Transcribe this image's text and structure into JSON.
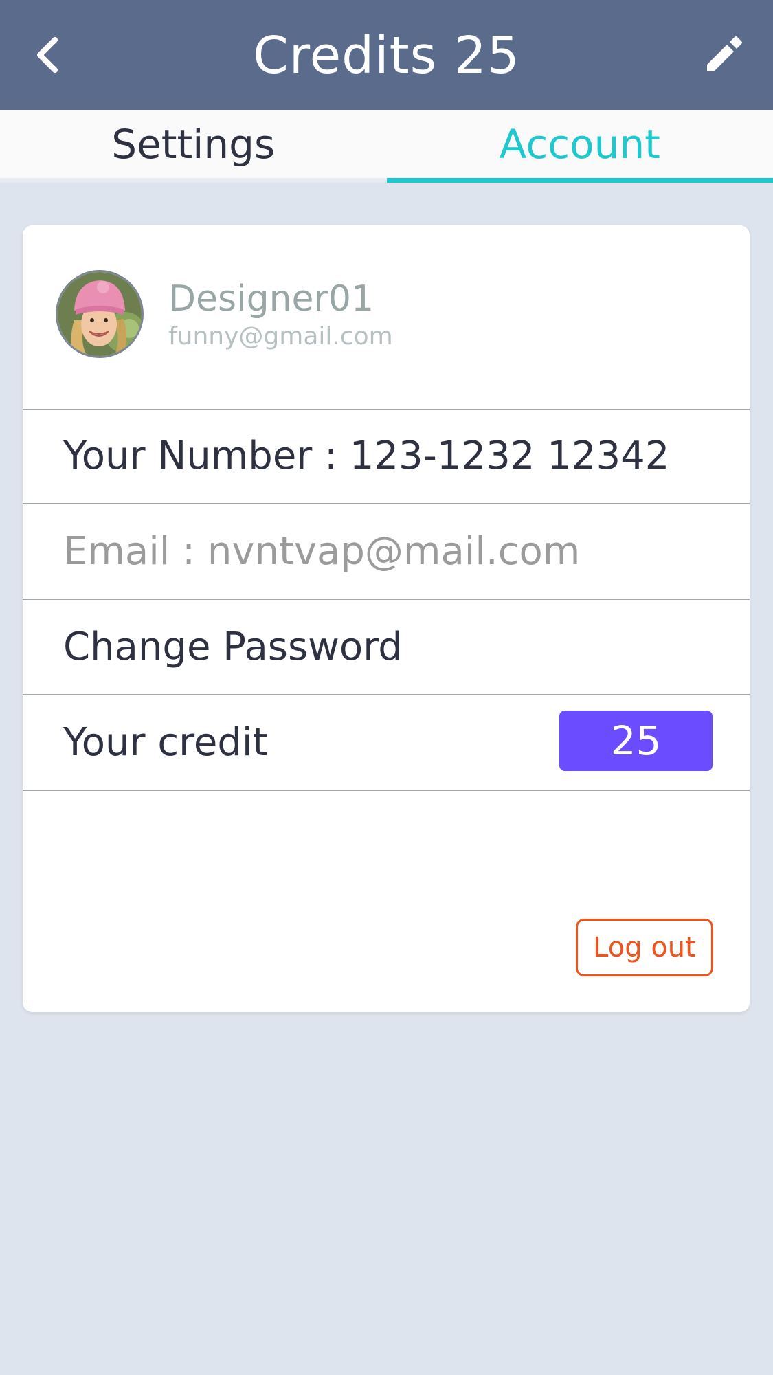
{
  "header": {
    "title": "Credits 25",
    "back_icon": "chevron-left-icon",
    "edit_icon": "pencil-icon",
    "background_color": "#5b6b8b"
  },
  "tabs": [
    {
      "label": "Settings",
      "active": false
    },
    {
      "label": "Account",
      "active": true
    }
  ],
  "accent_color": "#1dc9cc",
  "profile": {
    "name": "Designer01",
    "email": "funny@gmail.com",
    "avatar_icon": "user-avatar"
  },
  "rows": {
    "number": "Your Number : 123-1232 12342",
    "email": "Email : nvntvap@mail.com",
    "change_password": "Change Password",
    "credit_label": "Your credit",
    "credit_value": "25"
  },
  "credit_badge_color": "#6c4cff",
  "logout": {
    "label": "Log out",
    "color": "#f0541c"
  }
}
